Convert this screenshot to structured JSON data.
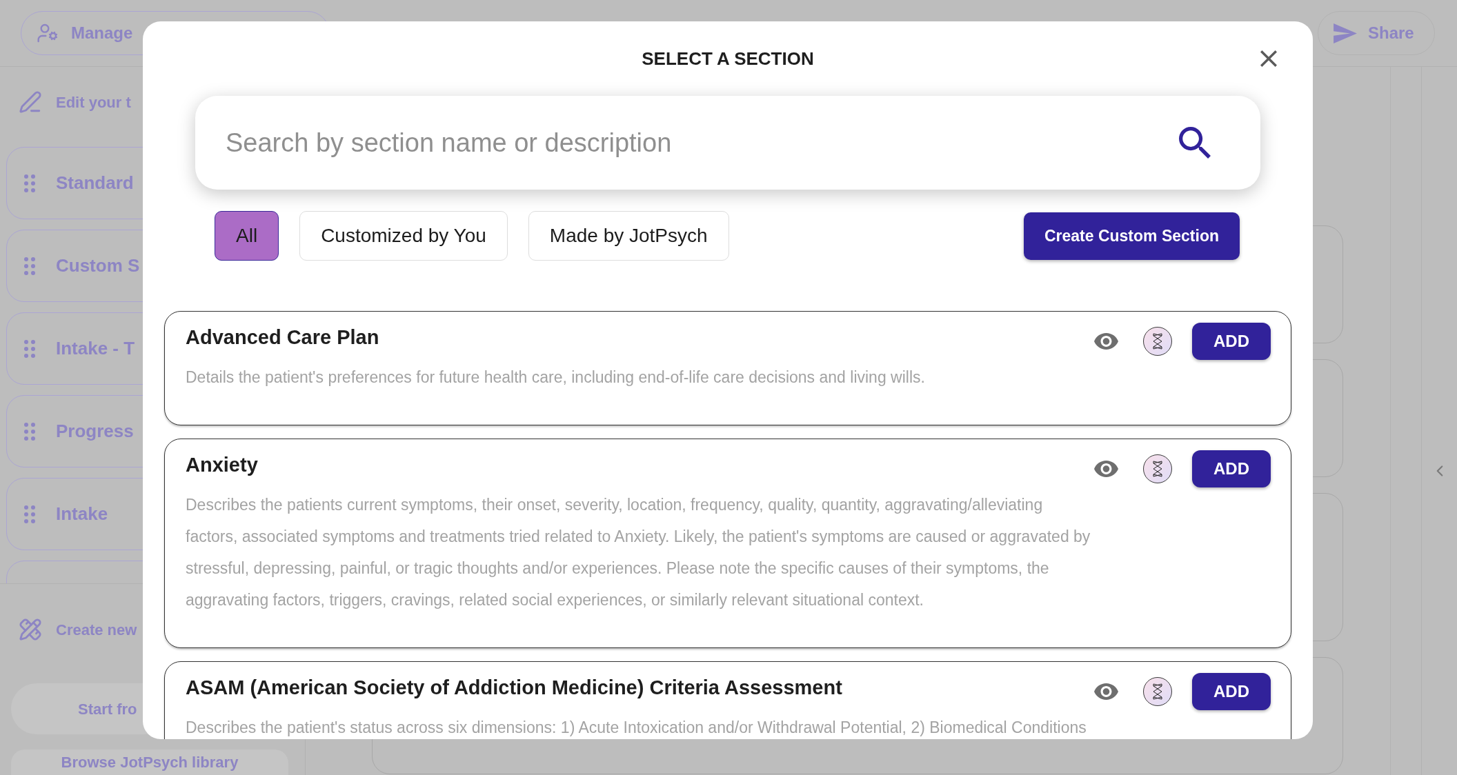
{
  "toolbar": {
    "manage_button": "Manage",
    "share_button": "Share"
  },
  "sidebar": {
    "edit_heading": "Edit your t",
    "templates": [
      "Standard",
      "Custom S",
      "Intake - T",
      "Progress",
      "Intake"
    ],
    "create_heading": "Create new",
    "start_button": "Start fro",
    "browse_button": "Browse JotPsych library"
  },
  "dialog": {
    "title": "SELECT A SECTION",
    "search": {
      "placeholder": "Search by section name or description"
    },
    "filters": [
      {
        "label": "All",
        "selected": true
      },
      {
        "label": "Customized by You",
        "selected": false
      },
      {
        "label": "Made by JotPsych",
        "selected": false
      }
    ],
    "create_button": "Create Custom Section",
    "sections": [
      {
        "name": "Advanced Care Plan",
        "description": "Details the patient's preferences for future health care, including end-of-life care decisions and living wills.",
        "button": "ADD"
      },
      {
        "name": "Anxiety",
        "description": "Describes the patients current symptoms, their onset, severity, location, frequency, quality, quantity, aggravating/alleviating factors, associated symptoms and treatments tried related to Anxiety. Likely, the patient's symptoms are caused or aggravated by stressful, depressing, painful, or tragic thoughts and/or experiences. Please note the specific causes of their symptoms, the aggravating factors, triggers, cravings, related social experiences, or similarly relevant situational context.",
        "button": "ADD"
      },
      {
        "name": "ASAM (American Society of Addiction Medicine) Criteria Assessment",
        "description": "Describes the patient's status across six dimensions: 1) Acute Intoxication and/or Withdrawal Potential, 2) Biomedical Conditions",
        "button": "ADD"
      }
    ]
  }
}
